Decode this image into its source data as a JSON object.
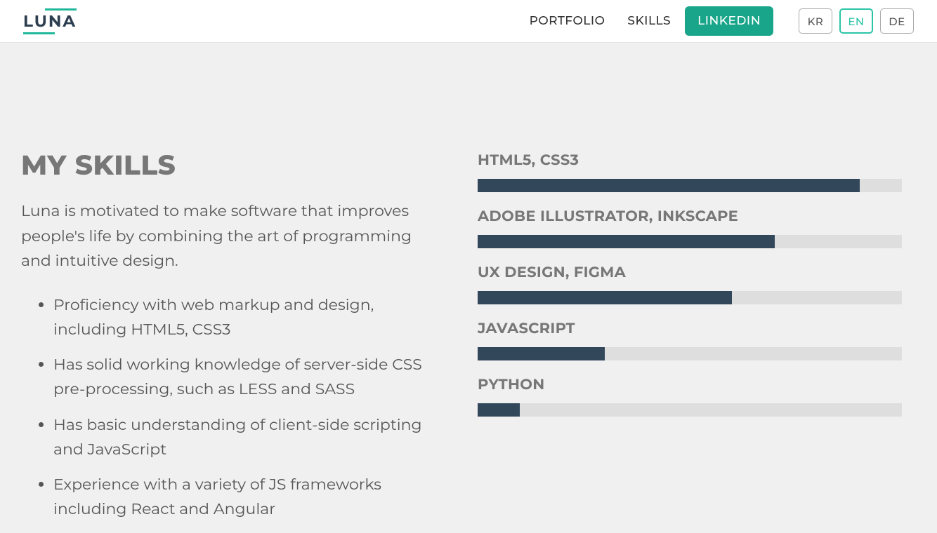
{
  "header": {
    "logo": "LUNA",
    "nav": [
      {
        "label": "PORTFOLIO",
        "cta": false
      },
      {
        "label": "SKILLS",
        "cta": false
      },
      {
        "label": "LINKEDIN",
        "cta": true
      }
    ],
    "langs": [
      {
        "code": "KR",
        "active": false
      },
      {
        "code": "EN",
        "active": true
      },
      {
        "code": "DE",
        "active": false
      }
    ]
  },
  "skills_section": {
    "title": "MY SKILLS",
    "intro": "Luna is motivated to make software that improves people's life by combining the art of programming and intuitive design.",
    "bullets": [
      "Proficiency with web markup and design, including HTML5, CSS3",
      "Has solid working knowledge of server-side CSS pre-processing, such as LESS and SASS",
      "Has basic understanding of client-side scripting and JavaScript",
      "Experience with a variety of JS frameworks including React and Angular"
    ]
  },
  "chart_data": {
    "type": "bar",
    "orientation": "horizontal",
    "xlabel": "",
    "ylabel": "",
    "xlim": [
      0,
      100
    ],
    "categories": [
      "HTML5, CSS3",
      "ADOBE ILLUSTRATOR, INKSCAPE",
      "UX DESIGN, FIGMA",
      "JAVASCRIPT",
      "PYTHON"
    ],
    "values": [
      90,
      70,
      60,
      30,
      10
    ],
    "bar_color": "#33475b",
    "track_color": "#dedede"
  }
}
